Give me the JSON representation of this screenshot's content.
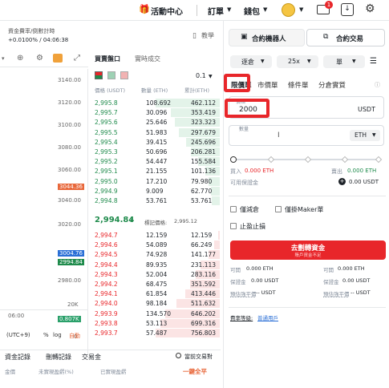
{
  "topbar": {
    "activity": "活動中心",
    "orders": "訂單",
    "wallet": "錢包",
    "notif_count": "1"
  },
  "funding": {
    "label": "資金費率/倒數計時",
    "value": "+0.0100% / 04:06:38",
    "tutorial": "教學"
  },
  "chart": {
    "ticks": [
      "3140.00",
      "3120.00",
      "3100.00",
      "3080.00",
      "3060.00",
      "3044.36",
      "3040.00",
      "3020.00",
      "3004.76",
      "2994.84",
      "2980.00",
      "20K",
      "0.807K",
      "0"
    ],
    "time": "06:00",
    "timezone": "(UTC+9)",
    "pct": "%",
    "log": "log",
    "auto": "自動"
  },
  "orderbook": {
    "tab_book": "買賣盤口",
    "tab_trades": "實時成交",
    "precision": "0.1",
    "col_price": "價格 (USDT)",
    "col_qty": "數量 (ETH)",
    "col_total": "累計(ETH)",
    "asks": [
      {
        "p": "2,995.8",
        "q": "108.692",
        "t": "462.112",
        "d": 1.0
      },
      {
        "p": "2,995.7",
        "q": "30.096",
        "t": "353.419",
        "d": 0.76
      },
      {
        "p": "2,995.6",
        "q": "25.646",
        "t": "323.323",
        "d": 0.7
      },
      {
        "p": "2,995.5",
        "q": "51.983",
        "t": "297.679",
        "d": 0.64
      },
      {
        "p": "2,995.4",
        "q": "39.415",
        "t": "245.696",
        "d": 0.53
      },
      {
        "p": "2,995.3",
        "q": "50.696",
        "t": "206.281",
        "d": 0.45
      },
      {
        "p": "2,995.2",
        "q": "54.447",
        "t": "155.584",
        "d": 0.34
      },
      {
        "p": "2,995.1",
        "q": "21.155",
        "t": "101.136",
        "d": 0.22
      },
      {
        "p": "2,995.0",
        "q": "17.210",
        "t": "79.980",
        "d": 0.17
      },
      {
        "p": "2,994.9",
        "q": "9.009",
        "t": "62.770",
        "d": 0.14
      },
      {
        "p": "2,994.8",
        "q": "53.761",
        "t": "53.761",
        "d": 0.12
      }
    ],
    "last_price": "2,994.84",
    "mark_label": "標記價格:",
    "mark_price": "2,995.12",
    "bids": [
      {
        "p": "2,994.7",
        "q": "12.159",
        "t": "12.159",
        "d": 0.03
      },
      {
        "p": "2,994.6",
        "q": "54.089",
        "t": "66.249",
        "d": 0.09
      },
      {
        "p": "2,994.5",
        "q": "74.928",
        "t": "141.177",
        "d": 0.18
      },
      {
        "p": "2,994.4",
        "q": "89.935",
        "t": "231.113",
        "d": 0.3
      },
      {
        "p": "2,994.3",
        "q": "52.004",
        "t": "283.116",
        "d": 0.37
      },
      {
        "p": "2,994.2",
        "q": "68.475",
        "t": "351.592",
        "d": 0.46
      },
      {
        "p": "2,994.1",
        "q": "61.854",
        "t": "413.446",
        "d": 0.54
      },
      {
        "p": "2,994.0",
        "q": "98.184",
        "t": "511.632",
        "d": 0.67
      },
      {
        "p": "2,993.9",
        "q": "134.570",
        "t": "646.202",
        "d": 0.85
      },
      {
        "p": "2,993.8",
        "q": "53.113",
        "t": "699.316",
        "d": 0.92
      },
      {
        "p": "2,993.7",
        "q": "57.487",
        "t": "756.803",
        "d": 1.0
      }
    ]
  },
  "bottom_tabs": {
    "funding_record": "資金記錄",
    "delist_record": "刪轉記錄",
    "bonus": "交易金",
    "current_pair": "當前交易對",
    "unrealized": "未實現盈虧(%)",
    "realized": "已實現盈虧",
    "close_all": "一鍵全平",
    "amount_label": "金價"
  },
  "panel": {
    "tab_bot": "合約機器人",
    "tab_trade": "合約交易",
    "margin_mode": "逐倉",
    "leverage": "25x",
    "position_mode": "單",
    "order_types": [
      "限價單",
      "市價單",
      "條件單",
      "分倉實質"
    ],
    "price_label": "價格",
    "price_value": "2000",
    "price_unit": "USDT",
    "qty_label": "數量",
    "qty_unit": "ETH",
    "buy_label": "買入",
    "buy_value": "0.000 ETH",
    "sell_label": "賣出",
    "sell_value": "0.000 ETH",
    "avail_label": "可用保證金",
    "avail_value": "0.00 USDT",
    "reduce_only": "僅減倉",
    "maker_only": "僅掛Maker單",
    "tpsl": "止盈止損",
    "action_main": "去劃轉資金",
    "action_sub": "賬戶資金不足",
    "open_label": "可開",
    "open_value": "0.000 ETH",
    "open_value2": "0.000 ETH",
    "margin_label": "保證金",
    "margin_value": "0.00 USDT",
    "margin_value2": "0.00 USDT",
    "liq_label": "預估強平價",
    "liq_value": "-- USDT",
    "liq_value2": "-- USDT",
    "fee_label": "費率等級:",
    "fee_value": "普通用戶"
  }
}
